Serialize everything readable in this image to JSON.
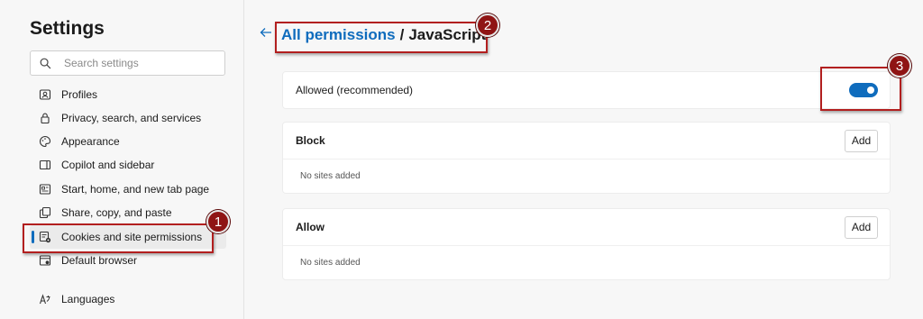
{
  "sidebar": {
    "title": "Settings",
    "search_placeholder": "Search settings",
    "items": [
      {
        "label": "Profiles",
        "icon": "profile-icon"
      },
      {
        "label": "Privacy, search, and services",
        "icon": "lock-icon"
      },
      {
        "label": "Appearance",
        "icon": "palette-icon"
      },
      {
        "label": "Copilot and sidebar",
        "icon": "sidebar-icon"
      },
      {
        "label": "Start, home, and new tab page",
        "icon": "home-icon"
      },
      {
        "label": "Share, copy, and paste",
        "icon": "share-icon"
      },
      {
        "label": "Cookies and site permissions",
        "icon": "cookies-icon",
        "active": true
      },
      {
        "label": "Default browser",
        "icon": "browser-icon"
      },
      {
        "label": "Languages",
        "icon": "languages-icon"
      }
    ]
  },
  "breadcrumb": {
    "link": "All permissions",
    "separator": "/",
    "current": "JavaScript"
  },
  "allowed": {
    "label": "Allowed (recommended)",
    "toggle_on": true
  },
  "block": {
    "title": "Block",
    "add_label": "Add",
    "empty_text": "No sites added"
  },
  "allow": {
    "title": "Allow",
    "add_label": "Add",
    "empty_text": "No sites added"
  },
  "annotations": [
    "1",
    "2",
    "3"
  ],
  "colors": {
    "accent": "#0f6cbd",
    "annotation": "#8f1414"
  }
}
